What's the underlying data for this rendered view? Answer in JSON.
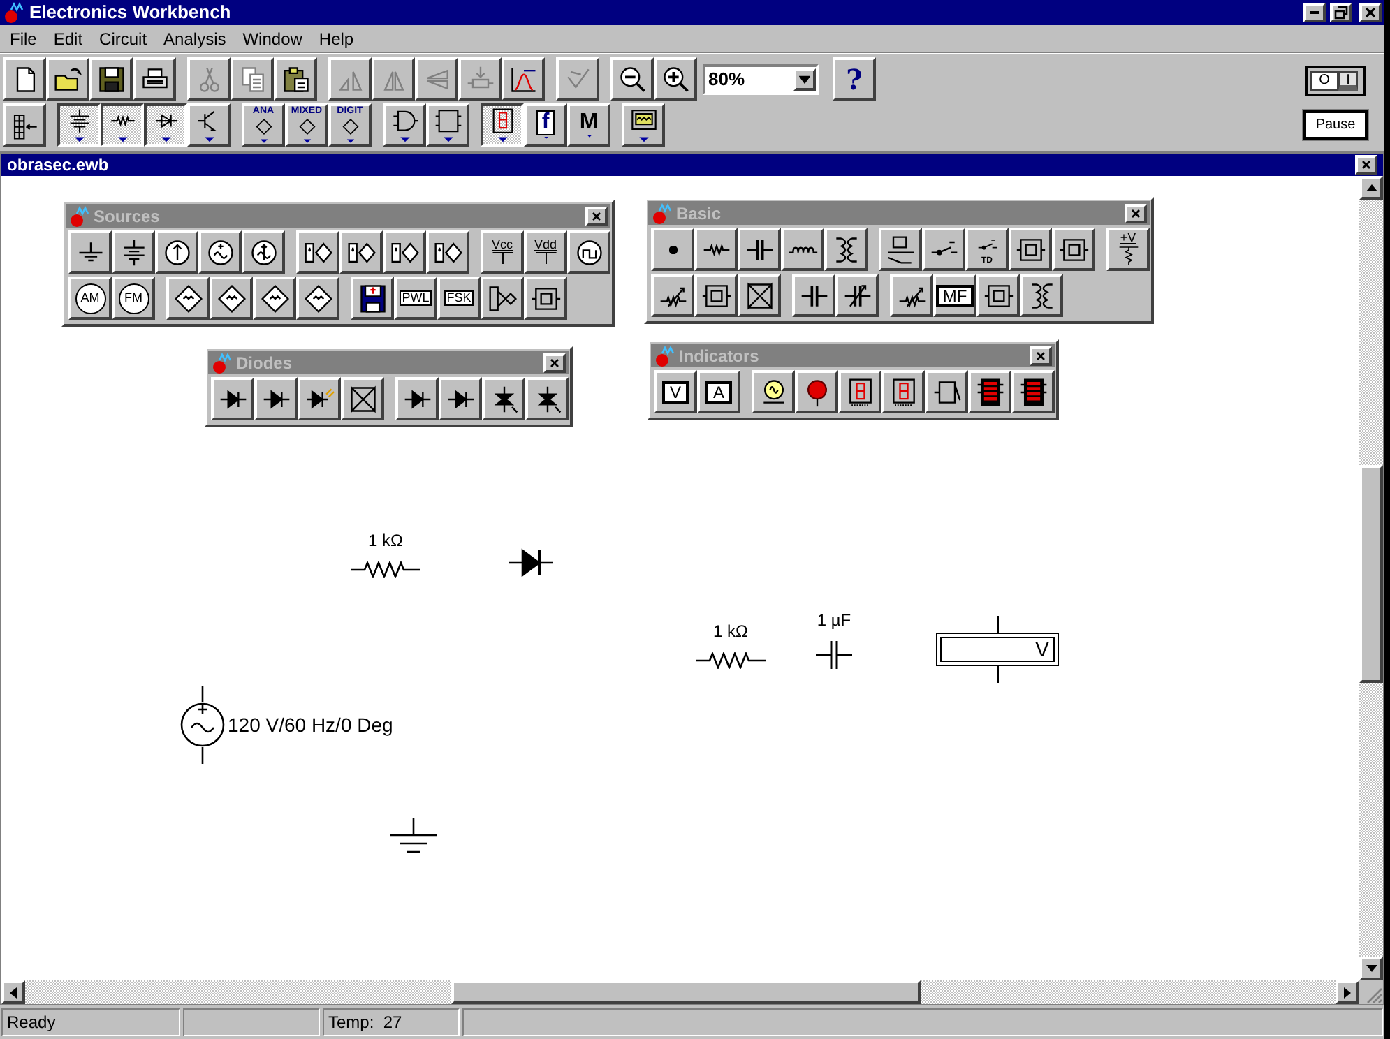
{
  "window": {
    "title": "Electronics Workbench"
  },
  "menu": [
    {
      "label": "File"
    },
    {
      "label": "Edit"
    },
    {
      "label": "Circuit"
    },
    {
      "label": "Analysis"
    },
    {
      "label": "Window"
    },
    {
      "label": "Help"
    }
  ],
  "toolbar": {
    "groups": [
      [
        {
          "kind": "new",
          "disabled": false
        },
        {
          "kind": "open",
          "disabled": false
        },
        {
          "kind": "save",
          "disabled": false
        },
        {
          "kind": "print",
          "disabled": false
        }
      ],
      [
        {
          "kind": "cut",
          "disabled": true
        },
        {
          "kind": "copy",
          "disabled": true
        },
        {
          "kind": "paste",
          "disabled": false
        }
      ],
      [
        {
          "kind": "rotate",
          "disabled": true
        },
        {
          "kind": "fliph",
          "disabled": true
        },
        {
          "kind": "flipv",
          "disabled": true
        },
        {
          "kind": "subcircuit",
          "disabled": true
        },
        {
          "kind": "graph",
          "disabled": false
        }
      ],
      [
        {
          "kind": "describe",
          "disabled": true
        }
      ],
      [
        {
          "kind": "zoomout",
          "disabled": false
        },
        {
          "kind": "zoomin",
          "disabled": false
        }
      ]
    ],
    "zoom": {
      "value": "80%"
    },
    "help": {
      "label": "?"
    }
  },
  "parts_toolbar": {
    "groups": [
      [
        {
          "kind": "partsbin",
          "selected": false
        }
      ],
      [
        {
          "kind": "sources",
          "selected": true
        },
        {
          "kind": "basic",
          "selected": true
        },
        {
          "kind": "diodes",
          "selected": true
        },
        {
          "kind": "transistors",
          "selected": false
        }
      ],
      [
        {
          "kind": "analog",
          "label": "ANA",
          "selected": false
        },
        {
          "kind": "mixed",
          "label": "MIXED",
          "selected": false
        },
        {
          "kind": "digital",
          "label": "DIGIT",
          "selected": false
        }
      ],
      [
        {
          "kind": "gates",
          "selected": false
        },
        {
          "kind": "flipflop",
          "selected": false
        }
      ],
      [
        {
          "kind": "indicators",
          "selected": true
        },
        {
          "kind": "controls",
          "label": "f",
          "selected": false
        },
        {
          "kind": "misc",
          "label": "M",
          "selected": false
        }
      ],
      [
        {
          "kind": "instruments",
          "selected": false
        }
      ]
    ]
  },
  "simulation": {
    "power_on": true,
    "power_off_label": "O",
    "power_on_label": "I",
    "pause": {
      "label": "Pause"
    }
  },
  "document": {
    "title": "obrasec.ewb",
    "palettes": [
      {
        "title": "Sources",
        "rows": [
          [
            [
              {
                "kind": "ground"
              },
              {
                "kind": "battery"
              },
              {
                "kind": "dccurrent"
              },
              {
                "kind": "acvoltage"
              },
              {
                "kind": "accurrent"
              }
            ],
            [
              {
                "kind": "depsource"
              },
              {
                "kind": "depsource"
              },
              {
                "kind": "depsource"
              },
              {
                "kind": "depsource"
              }
            ],
            [
              {
                "kind": "rail",
                "label": "Vcc"
              },
              {
                "kind": "rail",
                "label": "Vdd"
              },
              {
                "kind": "clock"
              }
            ]
          ],
          [
            [
              {
                "kind": "circled",
                "label": "AM"
              },
              {
                "kind": "circled",
                "label": "FM"
              }
            ],
            [
              {
                "kind": "diamond"
              },
              {
                "kind": "diamond"
              },
              {
                "kind": "diamond"
              },
              {
                "kind": "diamond"
              }
            ],
            [
              {
                "kind": "disk"
              },
              {
                "kind": "diamondtext",
                "label": "PWL"
              },
              {
                "kind": "diamondtext",
                "label": "FSK"
              },
              {
                "kind": "network"
              },
              {
                "kind": "module"
              }
            ]
          ]
        ]
      },
      {
        "title": "Basic",
        "rows": [
          [
            [
              {
                "kind": "connector"
              },
              {
                "kind": "resistor"
              },
              {
                "kind": "capacitor"
              },
              {
                "kind": "inductor"
              },
              {
                "kind": "transformer"
              }
            ],
            [
              {
                "kind": "relay"
              },
              {
                "kind": "switch"
              },
              {
                "kind": "switch",
                "label": "TD"
              },
              {
                "kind": "module"
              },
              {
                "kind": "module"
              }
            ],
            [
              {
                "kind": "pullup",
                "label": "+V"
              }
            ]
          ],
          [
            [
              {
                "kind": "potentiometer"
              },
              {
                "kind": "module"
              },
              {
                "kind": "bridge"
              }
            ],
            [
              {
                "kind": "capacitor"
              },
              {
                "kind": "varcapacitor"
              }
            ],
            [
              {
                "kind": "potentiometer"
              },
              {
                "kind": "boxtext",
                "label": "MF"
              },
              {
                "kind": "module"
              },
              {
                "kind": "transformer"
              }
            ]
          ]
        ]
      },
      {
        "title": "Diodes",
        "rows": [
          [
            [
              {
                "kind": "diode"
              },
              {
                "kind": "diode"
              },
              {
                "kind": "led"
              },
              {
                "kind": "bridge"
              }
            ],
            [
              {
                "kind": "diode"
              },
              {
                "kind": "diode"
              },
              {
                "kind": "triac"
              },
              {
                "kind": "triac"
              }
            ]
          ]
        ]
      },
      {
        "title": "Indicators",
        "rows": [
          [
            [
              {
                "kind": "boxtext",
                "label": "V"
              },
              {
                "kind": "boxtext",
                "label": "A"
              }
            ],
            [
              {
                "kind": "bulb"
              },
              {
                "kind": "probe"
              },
              {
                "kind": "segment"
              },
              {
                "kind": "segment"
              },
              {
                "kind": "buzzer"
              },
              {
                "kind": "bargraph"
              },
              {
                "kind": "bargraph"
              }
            ]
          ]
        ]
      }
    ],
    "components": [
      {
        "kind": "resistor",
        "label": "1 kΩ"
      },
      {
        "kind": "diode"
      },
      {
        "kind": "resistor",
        "label": "1 kΩ"
      },
      {
        "kind": "capacitor",
        "label": "1 µF"
      },
      {
        "kind": "voltmeter",
        "label": "V"
      },
      {
        "kind": "acsource",
        "label": "120 V/60 Hz/0 Deg"
      },
      {
        "kind": "ground"
      }
    ]
  },
  "status_bar": {
    "message": "Ready",
    "temperature": "Temp:  27"
  }
}
